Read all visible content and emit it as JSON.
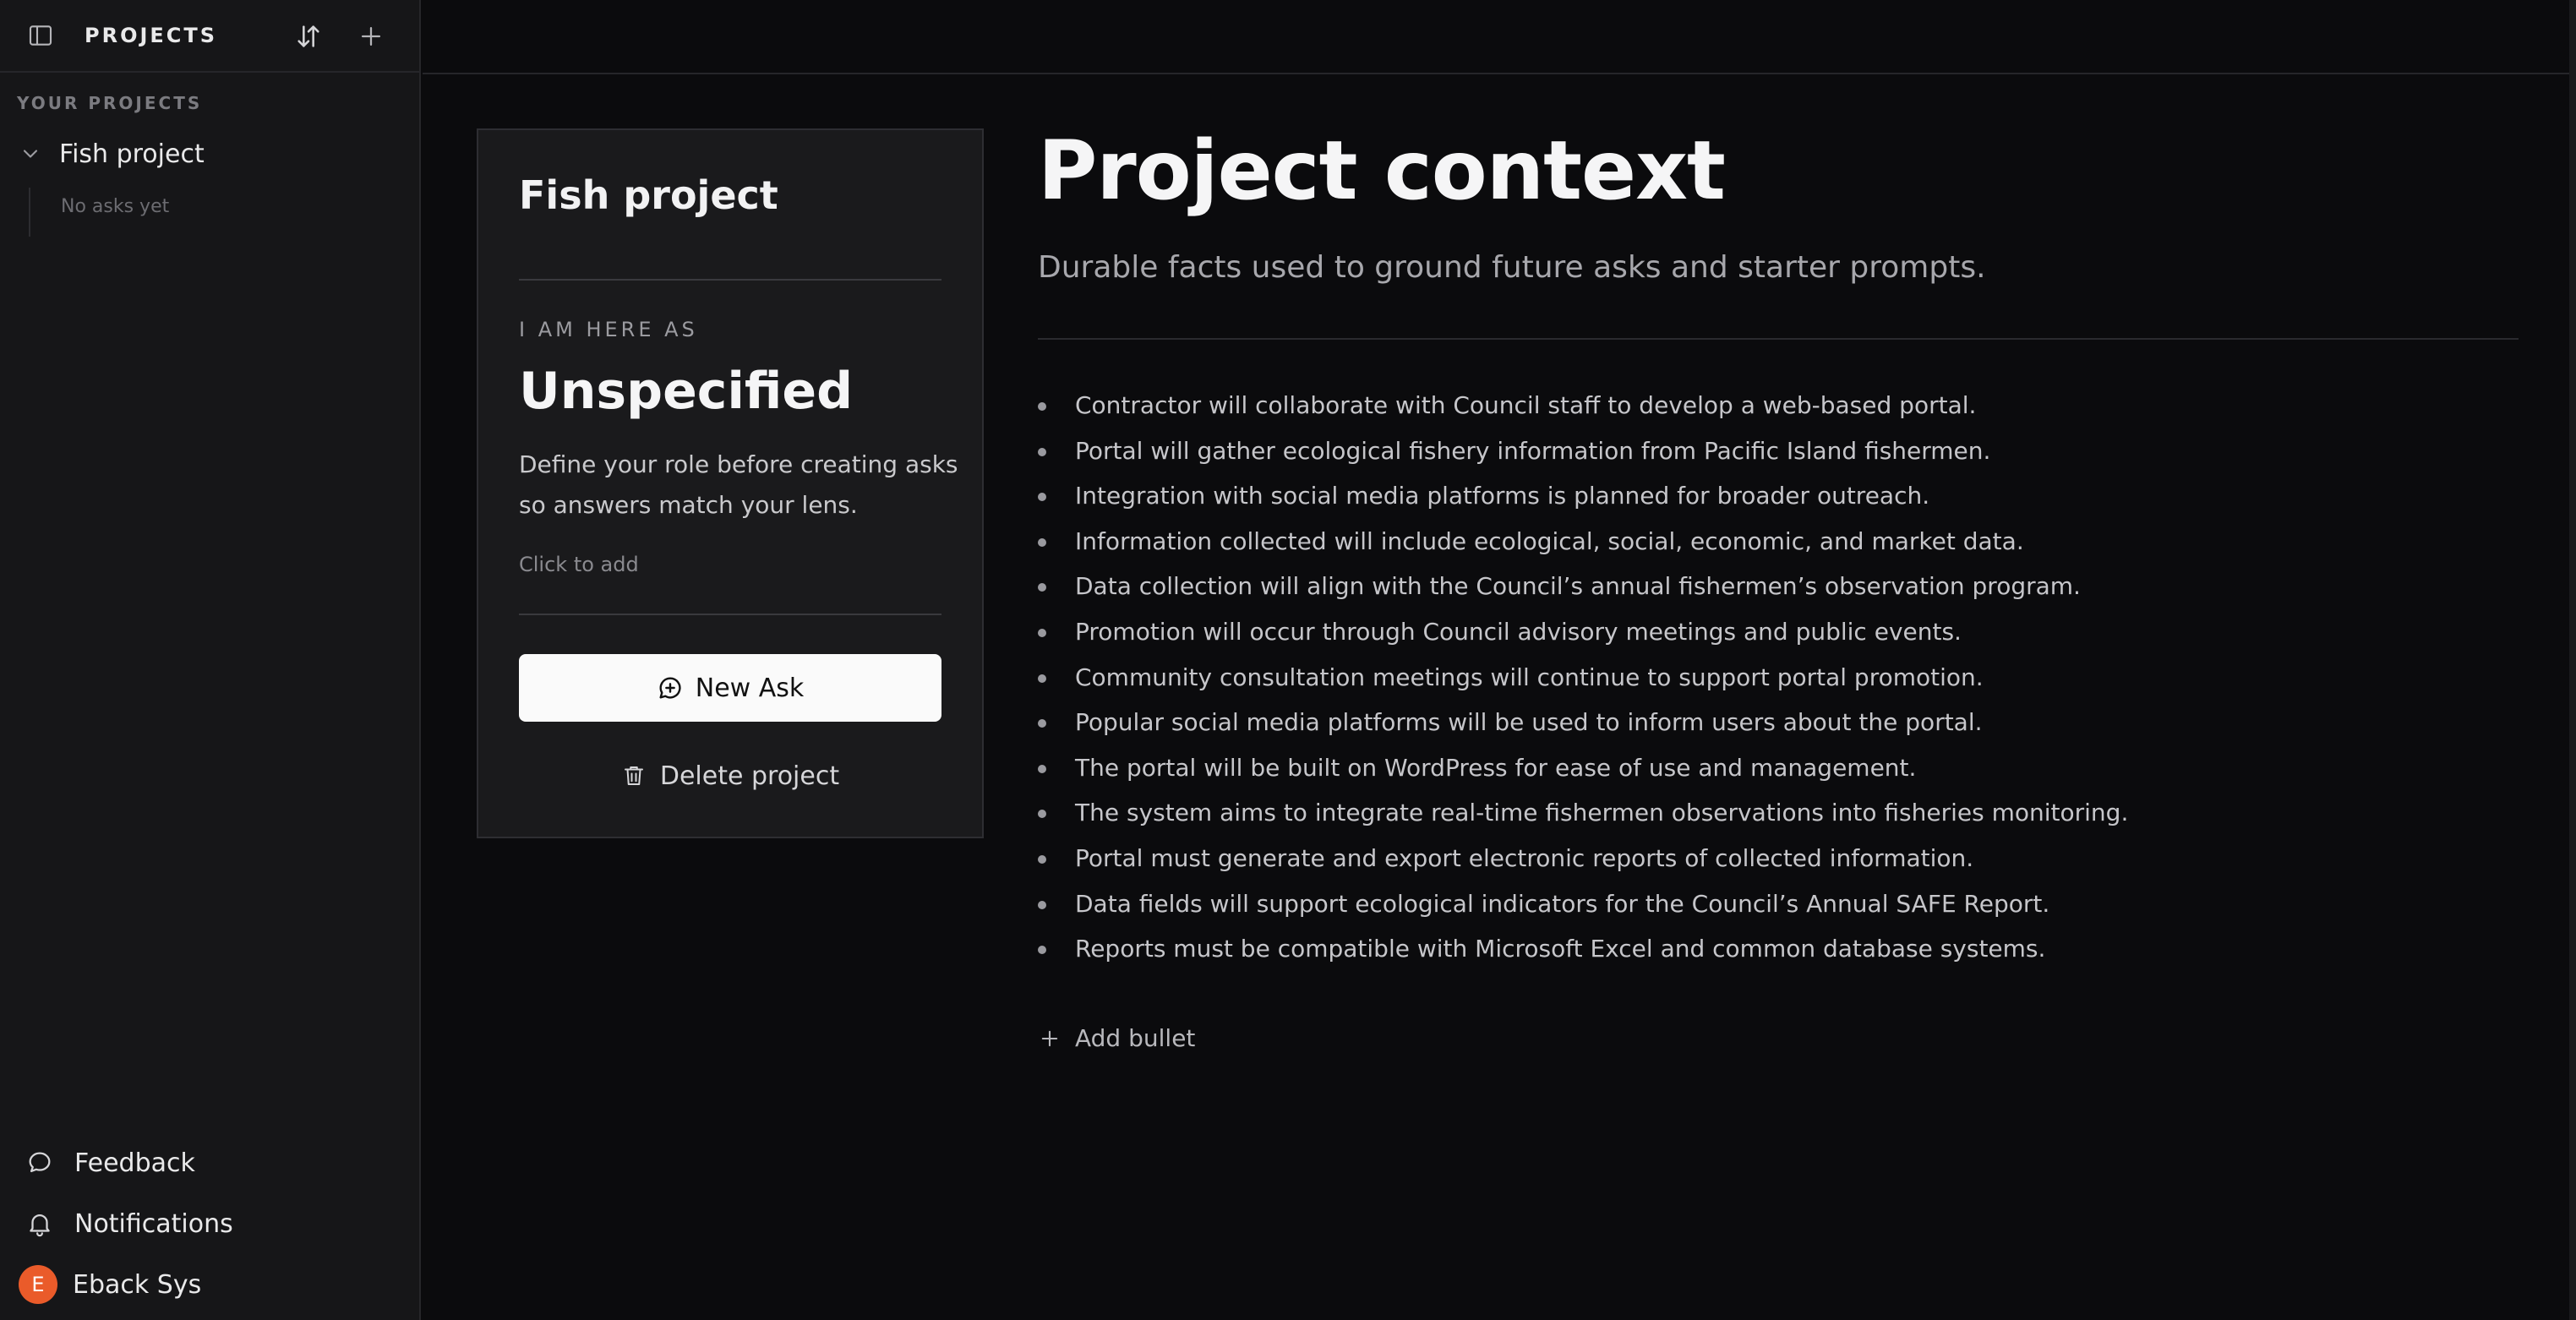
{
  "sidebar": {
    "title": "PROJECTS",
    "section_label": "YOUR PROJECTS",
    "projects": [
      {
        "name": "Fish project",
        "empty_text": "No asks yet",
        "expanded": true
      }
    ],
    "footer": {
      "feedback": "Feedback",
      "notifications": "Notifications",
      "user_name": "Eback Sys",
      "user_initial": "E",
      "avatar_color": "#ea5b2a"
    },
    "icons": [
      "sidebar-toggle-icon",
      "sort-icon",
      "plus-icon",
      "chevron-down-icon",
      "chat-bubble-icon",
      "bell-icon"
    ]
  },
  "card": {
    "project_name": "Fish project",
    "role_label": "I AM HERE AS",
    "role_value": "Unspecified",
    "role_description": "Define your role before creating asks so answers match your lens.",
    "click_to_add": "Click to add",
    "new_ask_label": "New Ask",
    "delete_label": "Delete project"
  },
  "context": {
    "title": "Project context",
    "subtitle": "Durable facts used to ground future asks and starter prompts.",
    "bullets": [
      "Contractor will collaborate with Council staff to develop a web-based portal.",
      "Portal will gather ecological fishery information from Pacific Island fishermen.",
      "Integration with social media platforms is planned for broader outreach.",
      "Information collected will include ecological, social, economic, and market data.",
      "Data collection will align with the Council’s annual fishermen’s observation program.",
      "Promotion will occur through Council advisory meetings and public events.",
      "Community consultation meetings will continue to support portal promotion.",
      "Popular social media platforms will be used to inform users about the portal.",
      "The portal will be built on WordPress for ease of use and management.",
      "The system aims to integrate real-time fishermen observations into fisheries monitoring.",
      "Portal must generate and export electronic reports of collected information.",
      "Data fields will support ecological indicators for the Council’s Annual SAFE Report.",
      "Reports must be compatible with Microsoft Excel and common database systems."
    ],
    "add_bullet_label": "Add bullet"
  },
  "theme": {
    "background": "#0b0b0d",
    "sidebar_bg": "#161618",
    "card_bg": "#1a1a1c",
    "primary_button_bg": "#fafafa"
  }
}
